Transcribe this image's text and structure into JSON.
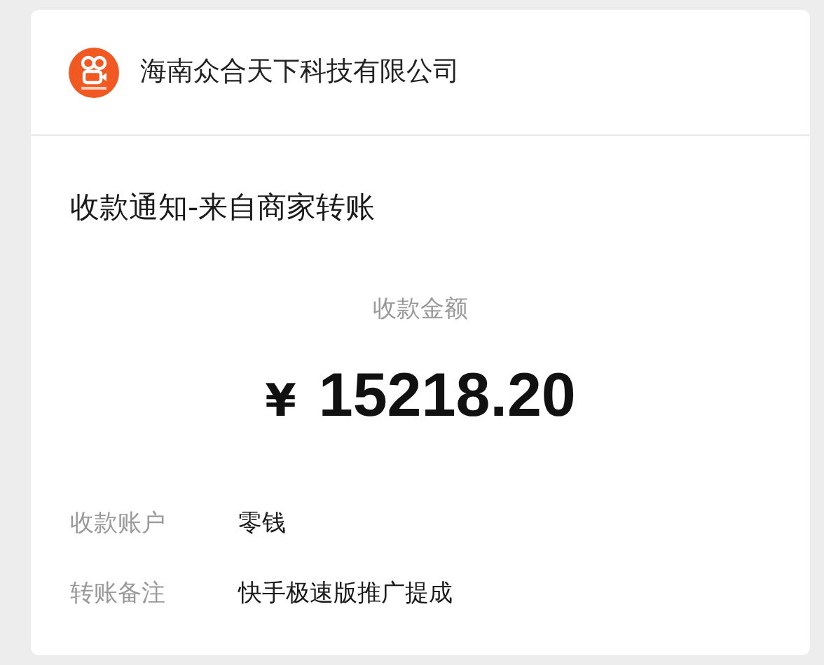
{
  "merchant": {
    "name": "海南众合天下科技有限公司"
  },
  "notice": {
    "title": "收款通知-来自商家转账"
  },
  "amount": {
    "label": "收款金额",
    "currency": "¥",
    "value": "15218.20"
  },
  "details": [
    {
      "label": "收款账户",
      "value": "零钱"
    },
    {
      "label": "转账备注",
      "value": "快手极速版推广提成"
    }
  ]
}
